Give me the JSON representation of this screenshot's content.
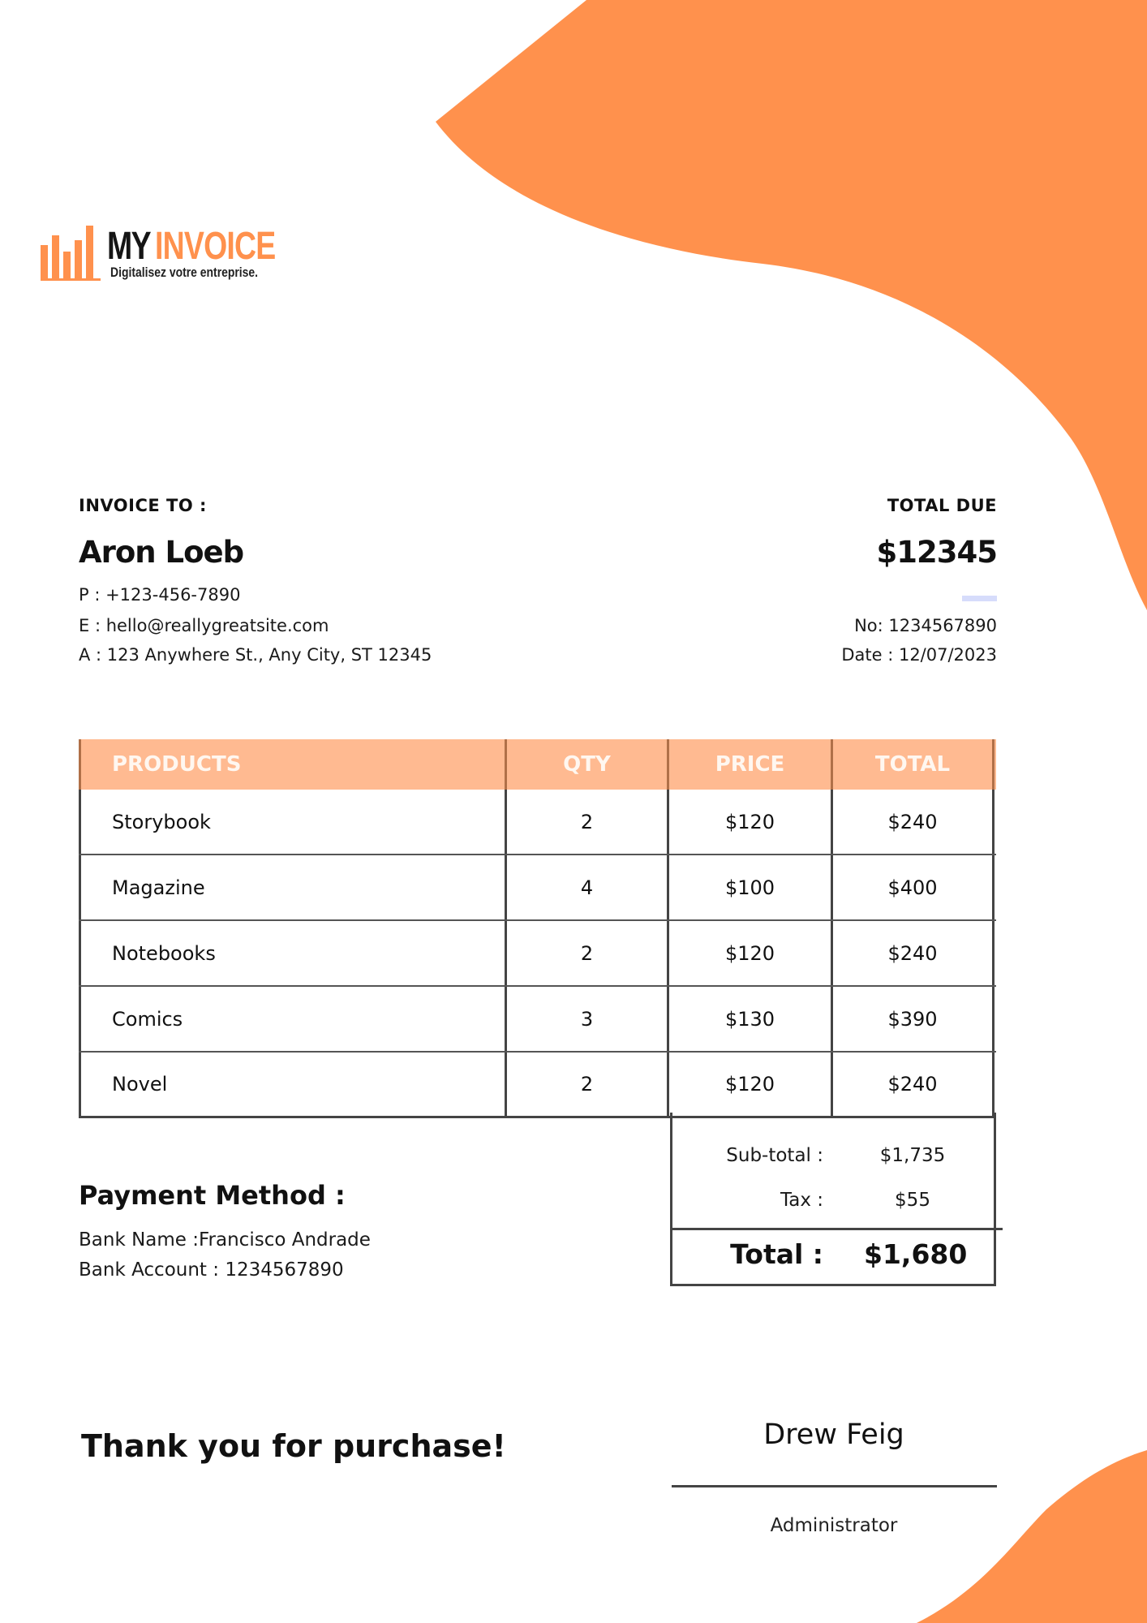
{
  "colors": {
    "accent": "#ff914d",
    "table_header": "#ffba91",
    "divider": "#d6dcfb",
    "border": "#444444"
  },
  "logo": {
    "word_my": "MY",
    "word_invoice": "INVOICE",
    "tagline": "Digitalisez votre entreprise.",
    "icon": "bar-chart-icon"
  },
  "invoice_to": {
    "label": "INVOICE TO :",
    "name": "Aron Loeb",
    "phone": "P : +123-456-7890",
    "email": "E : hello@reallygreatsite.com",
    "address": "A : 123 Anywhere St., Any City, ST 12345"
  },
  "total_due": {
    "label": "TOTAL DUE",
    "amount": "$12345",
    "number": "No: 1234567890",
    "date": "Date : 12/07/2023"
  },
  "table": {
    "headers": [
      "PRODUCTS",
      "QTY",
      "PRICE",
      "TOTAL"
    ],
    "rows": [
      [
        "Storybook",
        "2",
        "$120",
        "$240"
      ],
      [
        "Magazine",
        "4",
        "$100",
        "$400"
      ],
      [
        "Notebooks",
        "2",
        "$120",
        "$240"
      ],
      [
        "Comics",
        "3",
        "$130",
        "$390"
      ],
      [
        "Novel",
        "2",
        "$120",
        "$240"
      ]
    ]
  },
  "totals": {
    "subtotal_label": "Sub-total :",
    "subtotal": "$1,735",
    "tax_label": "Tax :",
    "tax": "$55",
    "total_label": "Total :",
    "total": "$1,680"
  },
  "payment": {
    "title": "Payment Method :",
    "bank_name": "Bank Name :Francisco Andrade",
    "bank_account": "Bank Account : 1234567890"
  },
  "thanks": "Thank you for purchase!",
  "signature": {
    "name": "Drew Feig",
    "role": "Administrator"
  }
}
